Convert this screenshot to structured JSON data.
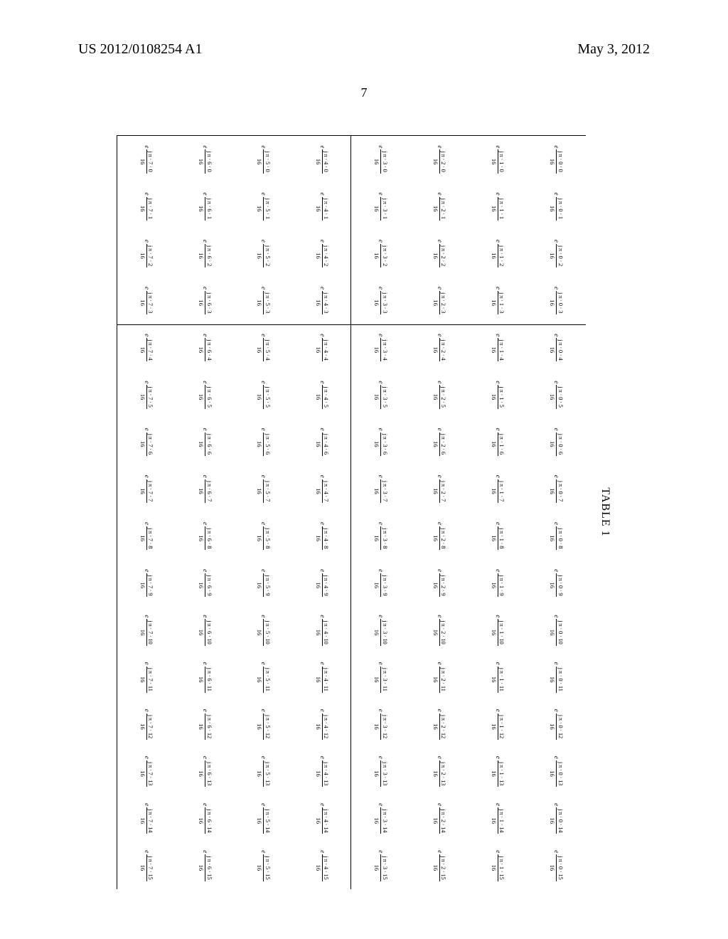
{
  "header": {
    "pub_number": "US 2012/0108254 A1",
    "pub_date": "May 3, 2012",
    "page_number": "7"
  },
  "table": {
    "label": "TABLE 1",
    "rows": 8,
    "cols": 16,
    "denominator": "16",
    "base_symbol": "e",
    "exponent_prefix": "j π ·",
    "vsep_after_col": 4,
    "hsep_rows": [
      4,
      5,
      6,
      7,
      8
    ]
  }
}
